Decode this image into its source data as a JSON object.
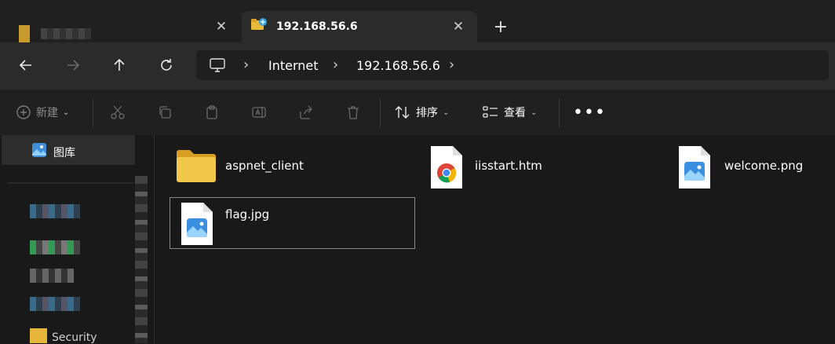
{
  "tabs": [
    {
      "label": "",
      "active": false
    },
    {
      "label": "192.168.56.6",
      "active": true
    }
  ],
  "address": {
    "crumbs": [
      "Internet",
      "192.168.56.6"
    ]
  },
  "command_bar": {
    "new_label": "新建",
    "sort_label": "排序",
    "view_label": "查看"
  },
  "sidebar": {
    "selected_label": "图库",
    "bottom_label": "Security"
  },
  "files": [
    {
      "name": "aspnet_client",
      "type": "folder-icon"
    },
    {
      "name": "iisstart.htm",
      "type": "chrome-icon"
    },
    {
      "name": "welcome.png",
      "type": "image-file-icon"
    },
    {
      "name": "flag.jpg",
      "type": "image-file-icon"
    }
  ]
}
